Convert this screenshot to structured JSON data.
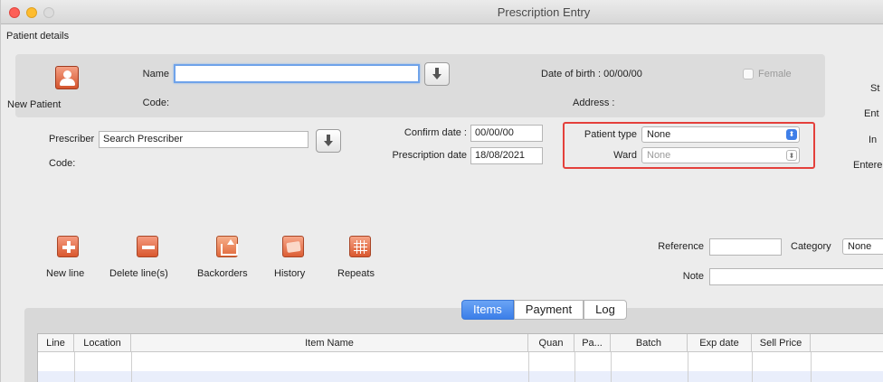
{
  "window": {
    "title": "Prescription Entry"
  },
  "patient": {
    "section_label": "Patient details",
    "new_patient_label": "New Patient",
    "name_label": "Name",
    "name_value": "",
    "code_label": "Code:",
    "dob_text": "Date of birth : 00/00/00",
    "female_label": "Female",
    "address_label": "Address :"
  },
  "right_edge": {
    "s": "St",
    "en": "Ent",
    "in": "In",
    "entered": "Entere"
  },
  "prescriber": {
    "label": "Prescriber",
    "value": "Search Prescriber",
    "code_label": "Code:",
    "confirm_date_label": "Confirm date :",
    "confirm_date_value": "00/00/00",
    "prescription_date_label": "Prescription date",
    "prescription_date_value": "18/08/2021"
  },
  "patient_type": {
    "label": "Patient type",
    "value": "None",
    "ward_label": "Ward",
    "ward_value": "None"
  },
  "toolbar": {
    "new_line": "New line",
    "delete_lines": "Delete line(s)",
    "backorders": "Backorders",
    "history": "History",
    "repeats": "Repeats"
  },
  "meta": {
    "reference_label": "Reference",
    "reference_value": "",
    "category_label": "Category",
    "category_value": "None",
    "note_label": "Note",
    "note_value": ""
  },
  "tabs": [
    "Items",
    "Payment",
    "Log"
  ],
  "table": {
    "columns": [
      "Line",
      "Location",
      "Item Name",
      "Quan",
      "Pa...",
      "Batch",
      "Exp date",
      "Sell Price"
    ]
  }
}
